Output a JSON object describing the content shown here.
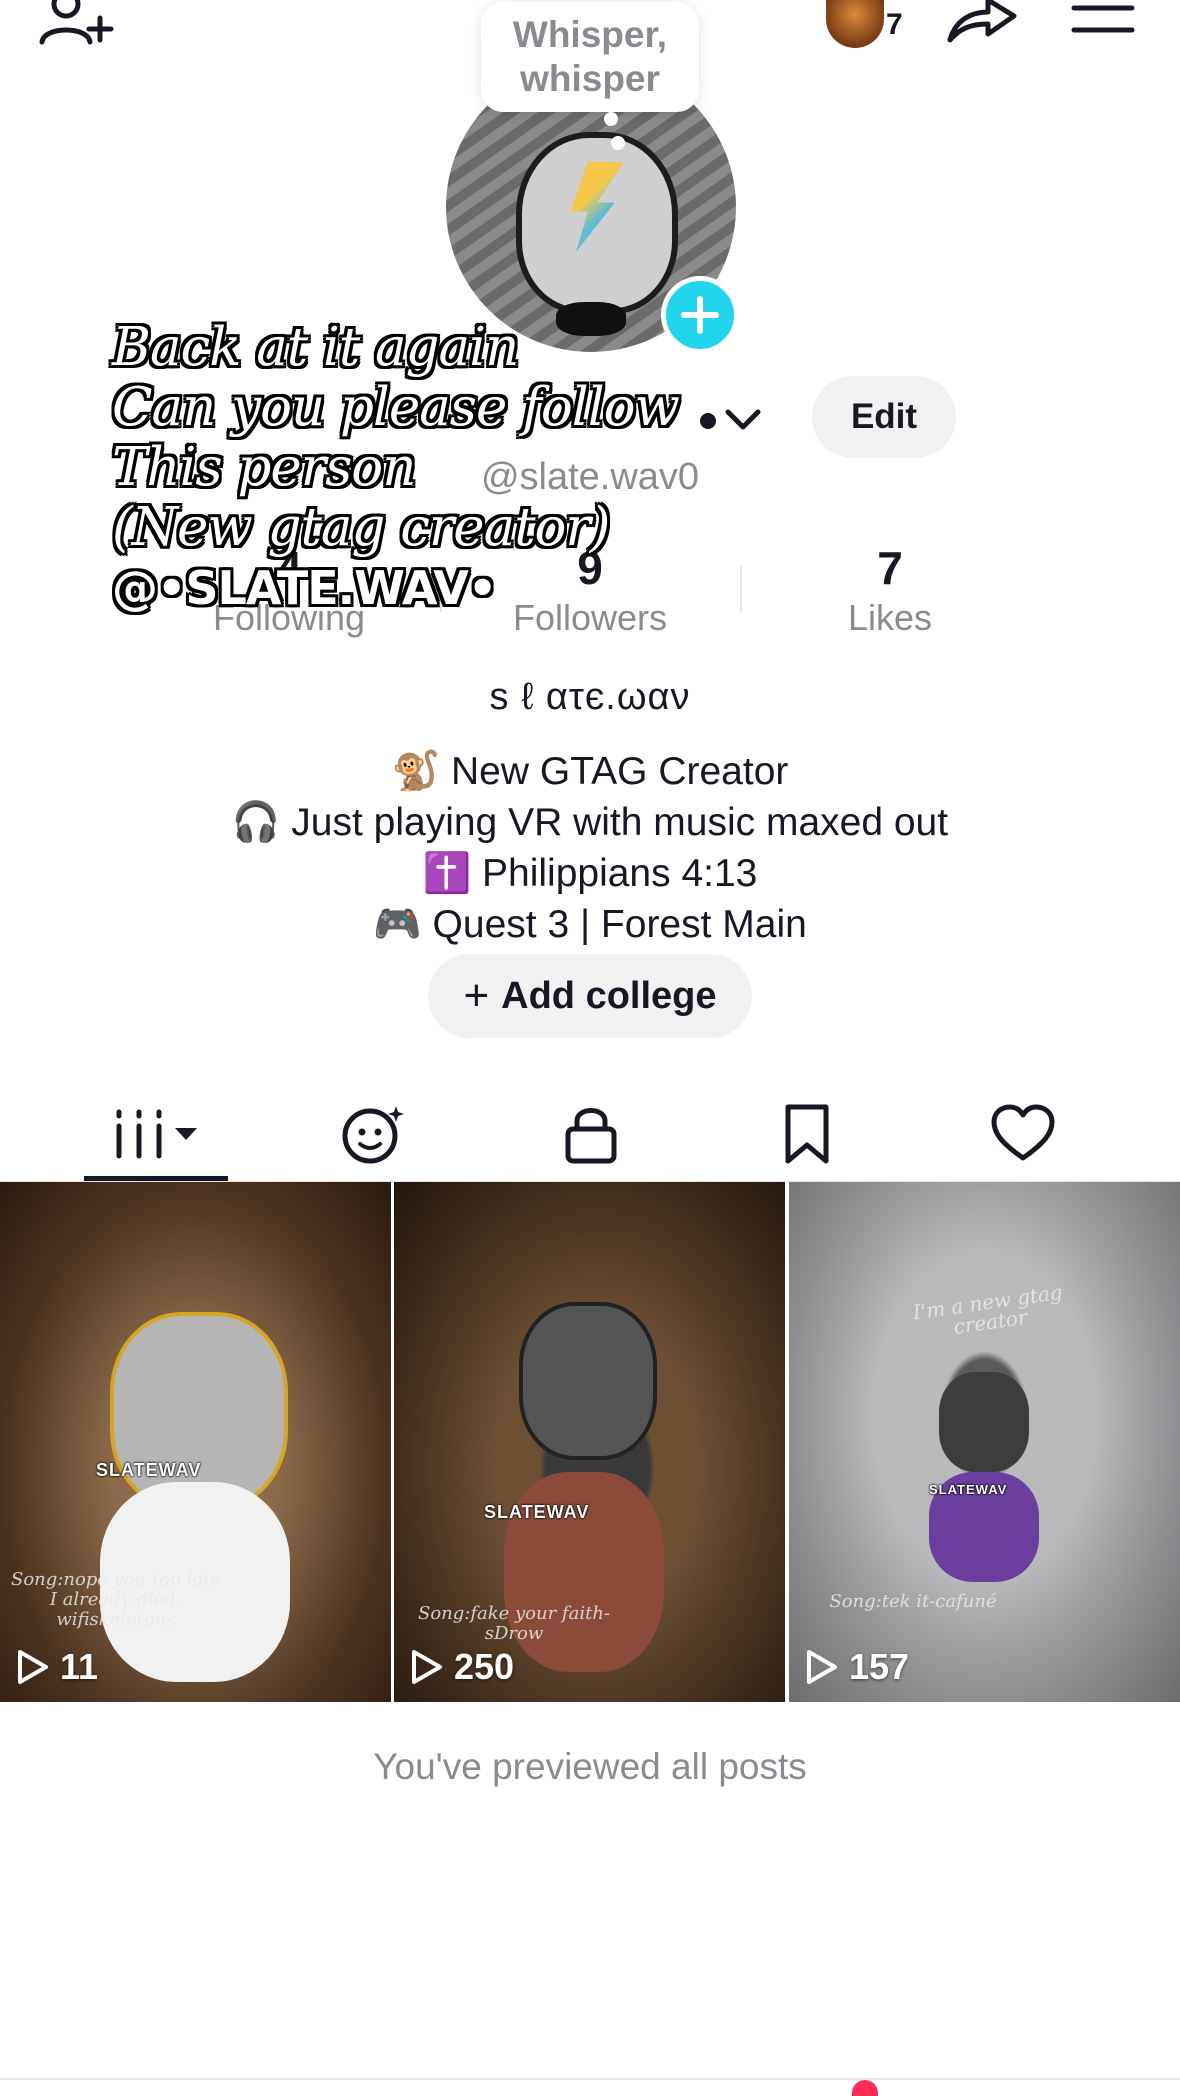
{
  "top_bar": {
    "add_user_icon": "add-user-icon",
    "friends_count": "7",
    "share_icon": "share-arrow-icon",
    "menu_icon": "hamburger-menu-icon"
  },
  "speech_bubble": {
    "text": "Whisper,\nwhisper"
  },
  "profile": {
    "handle": "@slate.wav0",
    "edit_label": "Edit",
    "nickname": "s ℓ ατє.ωαν",
    "add_college_label": "Add college"
  },
  "overlay_caption": {
    "lines": [
      "Back at it again",
      "Can you please follow",
      "This person",
      "(New gtag creator)"
    ],
    "handle": "@•SLATE.WAV•"
  },
  "stats": {
    "following": {
      "value": "4",
      "label": "Following"
    },
    "followers": {
      "value": "9",
      "label": "Followers"
    },
    "likes": {
      "value": "7",
      "label": "Likes"
    }
  },
  "bio": [
    "🐒 New GTAG Creator",
    "🎧 Just playing VR with music maxed out",
    "✝️ Philippians 4:13",
    "🎮 Quest 3 | Forest Main"
  ],
  "tabs": [
    {
      "name": "videos",
      "icon": "grid-bars-icon",
      "active": true
    },
    {
      "name": "reposts",
      "icon": "repost-face-icon"
    },
    {
      "name": "private",
      "icon": "lock-icon"
    },
    {
      "name": "saved",
      "icon": "bookmark-icon"
    },
    {
      "name": "liked",
      "icon": "heart-icon"
    }
  ],
  "videos": [
    {
      "views": "11",
      "tag": "SLATEWAV",
      "caption": "Song:nope you too late\nI already died-\nwifiskeletons"
    },
    {
      "views": "250",
      "tag": "SLATEWAV",
      "caption": "Song:fake your faith-\nsDrow"
    },
    {
      "views": "157",
      "tag": "SLATEWAV",
      "caption": "Song:tek it-cafuné",
      "title_text": "I'm a new gtag creator"
    }
  ],
  "footer": {
    "previewed_text": "You've previewed all posts"
  },
  "colors": {
    "accent_blue": "#20d5ec",
    "brand_red": "#fe2c55",
    "text_primary": "#161823",
    "text_secondary": "#8a8b91",
    "button_bg": "#f1f1f2"
  }
}
